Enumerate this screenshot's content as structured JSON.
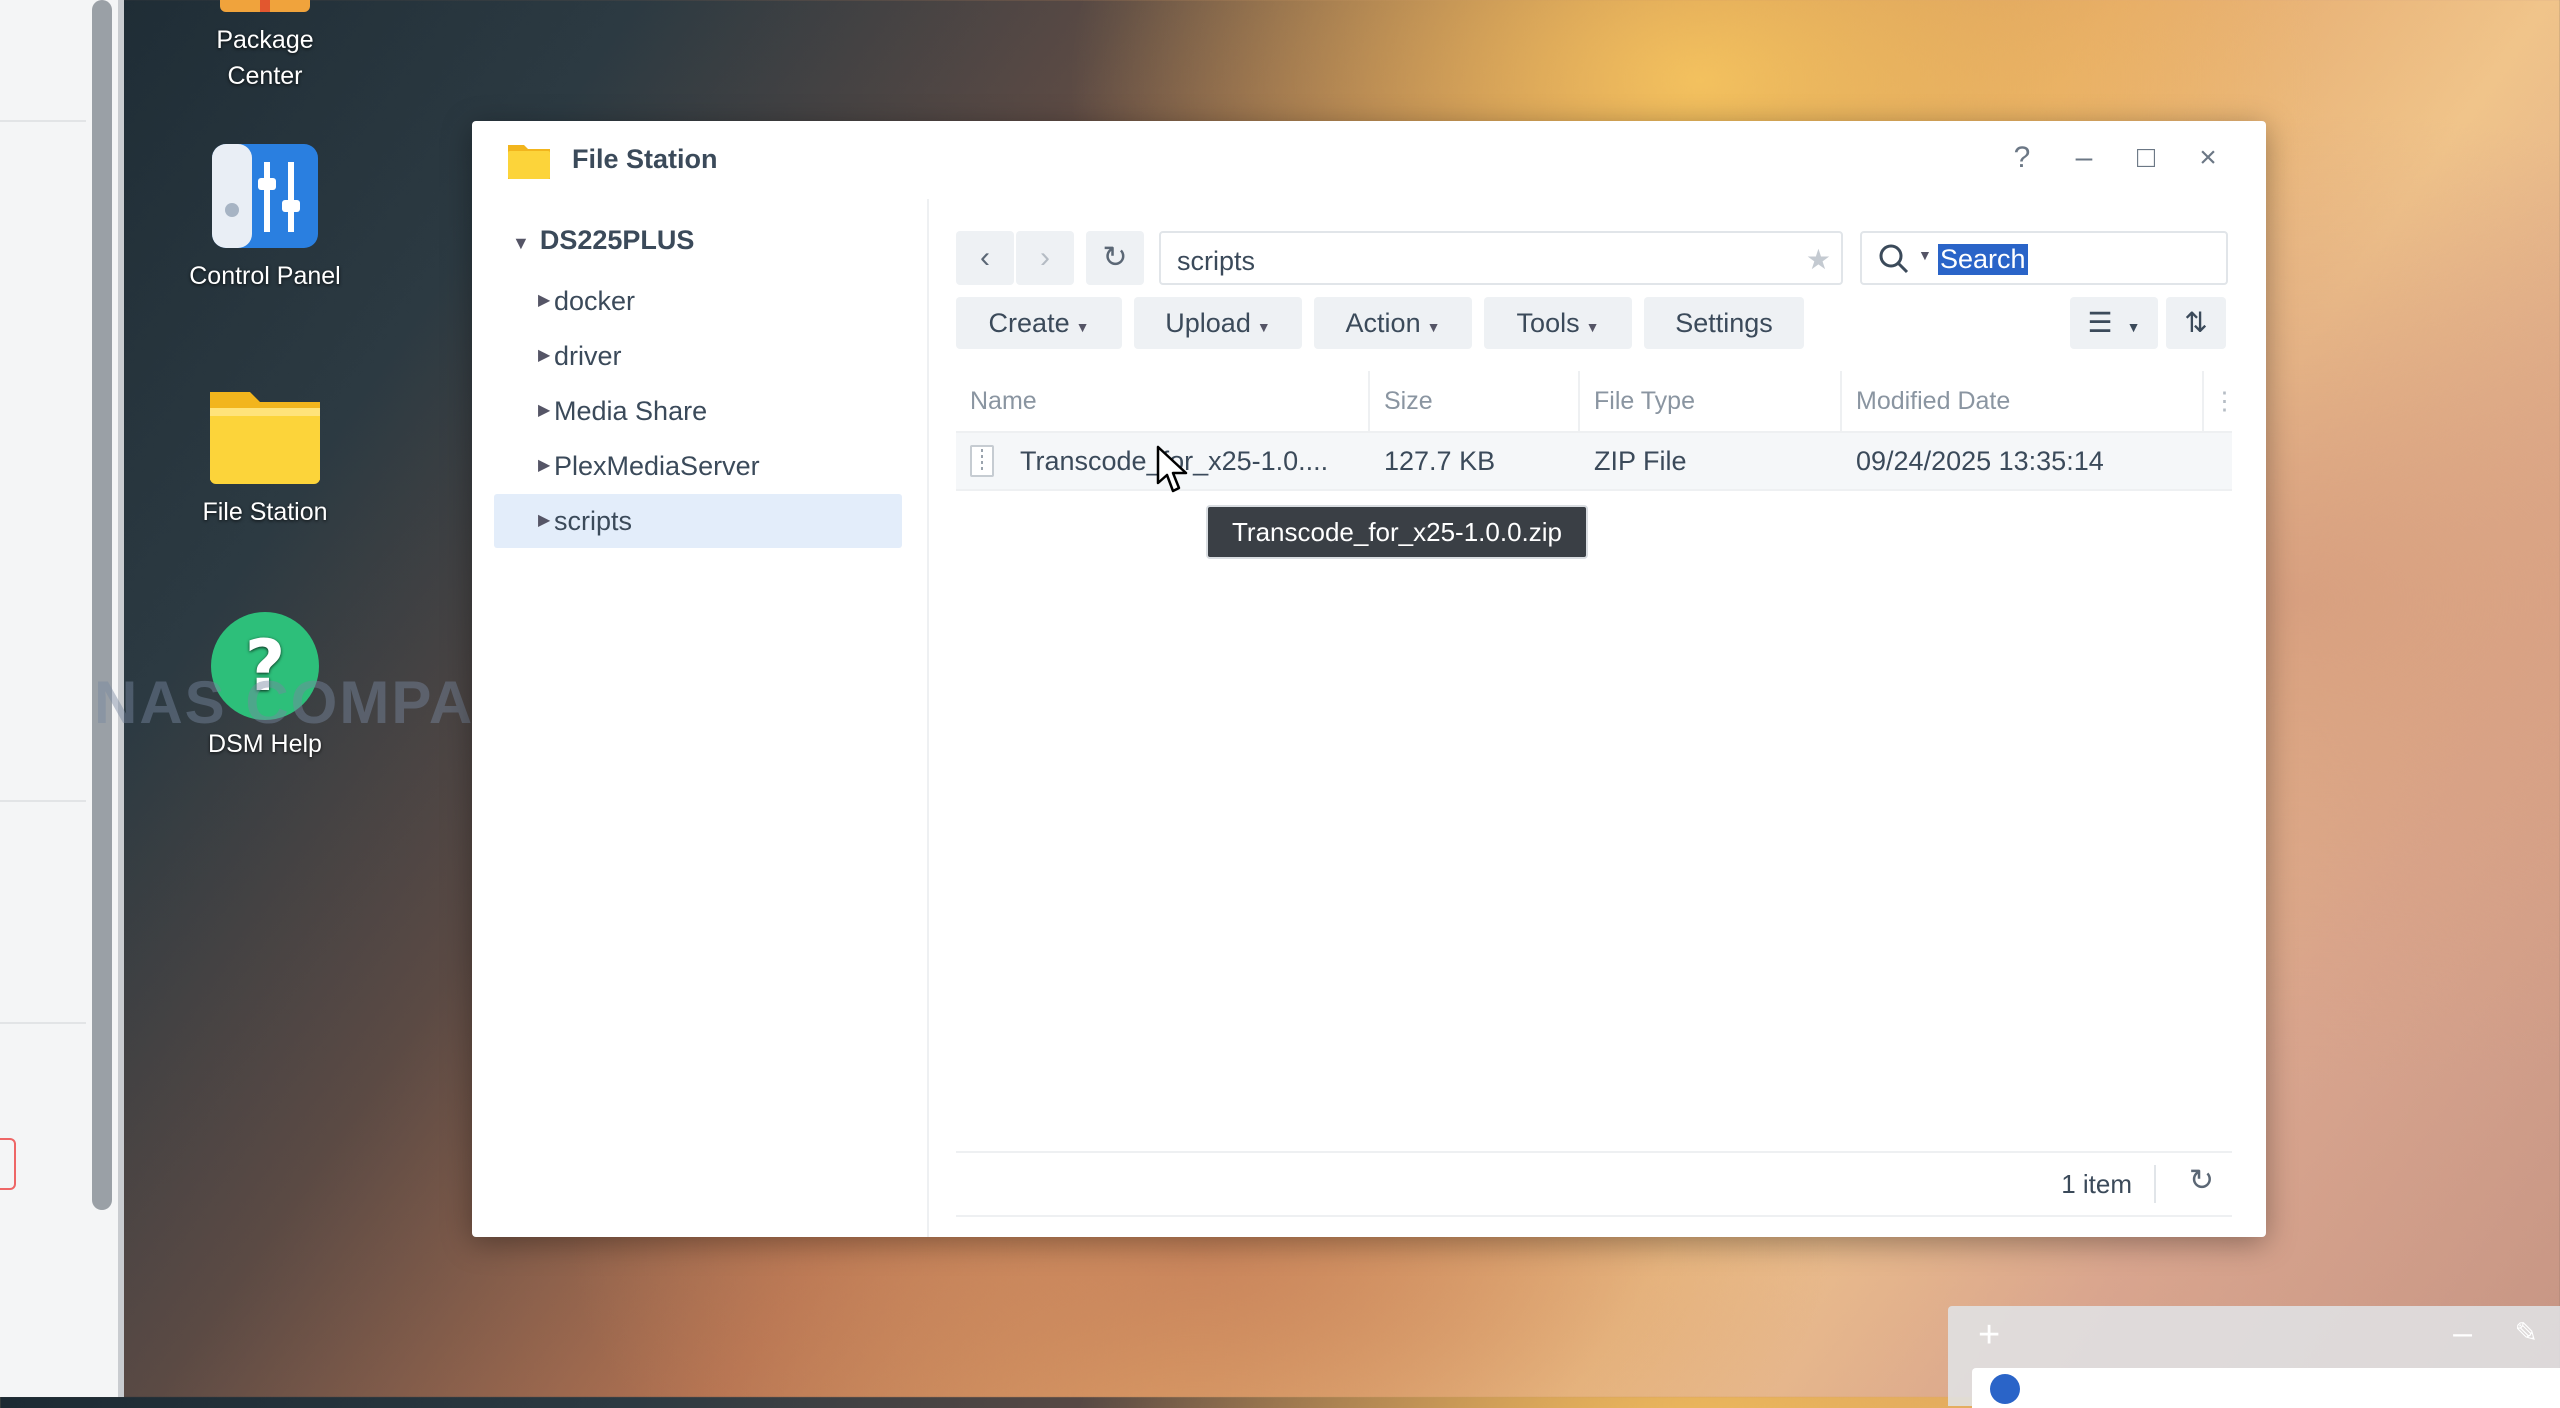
{
  "desktop": {
    "icons": [
      {
        "label_line1": "Package",
        "label_line2": "Center"
      },
      {
        "label": "Control Panel"
      },
      {
        "label": "File Station"
      },
      {
        "label": "DSM Help"
      }
    ],
    "watermark": "NAS COMPARES"
  },
  "window": {
    "title": "File Station",
    "controls": {
      "help": "?",
      "minimize": "–",
      "maximize": "□",
      "close": "×"
    }
  },
  "sidebar": {
    "root": "DS225PLUS",
    "items": [
      {
        "label": "docker"
      },
      {
        "label": "driver"
      },
      {
        "label": "Media Share"
      },
      {
        "label": "PlexMediaServer"
      },
      {
        "label": "scripts",
        "selected": true
      }
    ]
  },
  "toolbar": {
    "path": "scripts",
    "search_text": "Search",
    "buttons": [
      "Create",
      "Upload",
      "Action",
      "Tools",
      "Settings"
    ]
  },
  "table": {
    "columns": [
      "Name",
      "Size",
      "File Type",
      "Modified Date"
    ],
    "rows": [
      {
        "name": "Transcode_for_x25-1.0....",
        "size": "127.7 KB",
        "type": "ZIP File",
        "modified": "09/24/2025 13:35:14"
      }
    ],
    "tooltip": "Transcode_for_x25-1.0.0.zip"
  },
  "status": {
    "count": "1 item"
  },
  "colors": {
    "accent": "#2a64c8",
    "selected_row": "#e3edfa",
    "text": "#3b4a5a"
  }
}
